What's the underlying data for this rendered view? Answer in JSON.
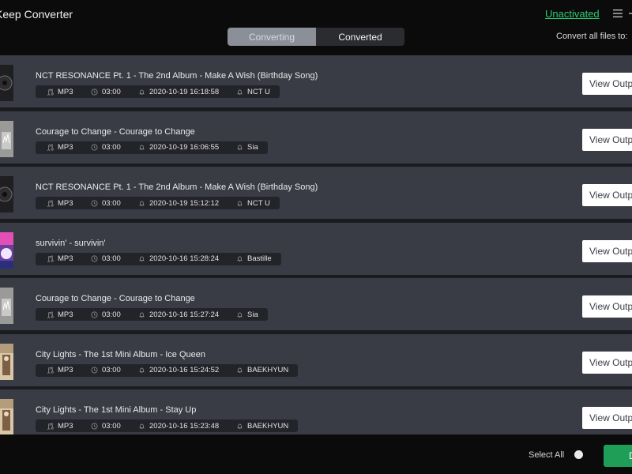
{
  "app": {
    "title": "Keep Converter"
  },
  "header": {
    "unactivated_label": "Unactivated",
    "convert_all_label": "Convert all files to:"
  },
  "tabs": [
    {
      "label": "Converting",
      "active": false
    },
    {
      "label": "Converted",
      "active": true
    }
  ],
  "rows": [
    {
      "title": "NCT RESONANCE Pt. 1 - The 2nd Album - Make A Wish (Birthday Song)",
      "format": "MP3",
      "duration": "03:00",
      "date": "2020-10-19 16:18:58",
      "artist": "NCT U",
      "action": "View Output"
    },
    {
      "title": "Courage to Change - Courage to Change",
      "format": "MP3",
      "duration": "03:00",
      "date": "2020-10-19 16:06:55",
      "artist": "Sia",
      "action": "View Output"
    },
    {
      "title": "NCT RESONANCE Pt. 1 - The 2nd Album - Make A Wish (Birthday Song)",
      "format": "MP3",
      "duration": "03:00",
      "date": "2020-10-19 15:12:12",
      "artist": "NCT U",
      "action": "View Output"
    },
    {
      "title": "survivin' - survivin'",
      "format": "MP3",
      "duration": "03:00",
      "date": "2020-10-16 15:28:24",
      "artist": "Bastille",
      "action": "View Output"
    },
    {
      "title": "Courage to Change - Courage to Change",
      "format": "MP3",
      "duration": "03:00",
      "date": "2020-10-16 15:27:24",
      "artist": "Sia",
      "action": "View Output"
    },
    {
      "title": "City Lights - The 1st Mini Album - Ice Queen",
      "format": "MP3",
      "duration": "03:00",
      "date": "2020-10-16 15:24:52",
      "artist": "BAEKHYUN",
      "action": "View Output"
    },
    {
      "title": "City Lights - The 1st Mini Album - Stay Up",
      "format": "MP3",
      "duration": "03:00",
      "date": "2020-10-16 15:23:48",
      "artist": "BAEKHYUN",
      "action": "View Output"
    }
  ],
  "footer": {
    "select_all_label": "Select All",
    "primary_button_label": "Delete"
  },
  "colors": {
    "accent_green": "#2ecc71",
    "button_green": "#1e9e57",
    "row_bg": "#3a3c45",
    "meta_bg": "#23242a"
  },
  "icons": {
    "format": "music-note-icon",
    "duration": "clock-icon",
    "date": "bell-icon",
    "artist": "bell-icon",
    "menu": "hamburger-menu-icon"
  }
}
